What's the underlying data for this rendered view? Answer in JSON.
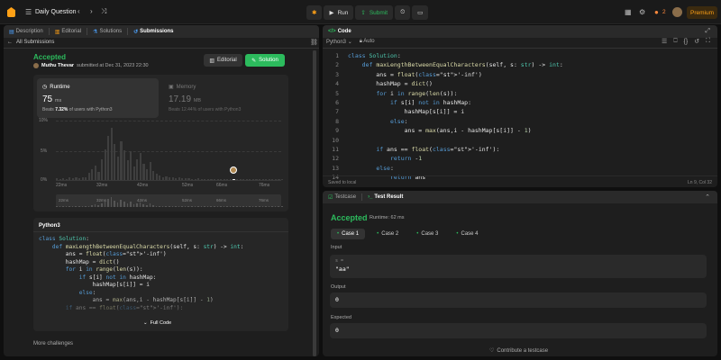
{
  "nav": {
    "title": "Daily Question",
    "run": "Run",
    "submit": "Submit",
    "streak": "2",
    "premium": "Premium"
  },
  "leftTabs": [
    {
      "label": "Description"
    },
    {
      "label": "Editorial"
    },
    {
      "label": "Solutions"
    },
    {
      "label": "Submissions"
    }
  ],
  "submission": {
    "back": "All Submissions",
    "status": "Accepted",
    "user": "Muthu Thevar",
    "submitted": "submitted at Dec 31, 2023 22:30",
    "editorial_btn": "Editorial",
    "solution_btn": "Solution",
    "runtime": {
      "label": "Runtime",
      "value": "75",
      "unit": "ms",
      "beats_label": "Beats",
      "beats": "7.32%",
      "beats_suffix": "of users with Python3"
    },
    "memory": {
      "label": "Memory",
      "value": "17.19",
      "unit": "MB",
      "beats_label": "Beats",
      "beats": "12.44%",
      "beats_suffix": "of users with Python3"
    },
    "y_ticks": [
      "10%",
      "5%",
      "0%"
    ],
    "x_ticks": [
      "22ms",
      "32ms",
      "42ms",
      "52ms",
      "66ms",
      "76ms"
    ],
    "mini_ticks": [
      "22ms",
      "32ms",
      "42ms",
      "52ms",
      "66ms",
      "76ms"
    ],
    "lang": "Python3",
    "full_code": "Full Code",
    "more": "More challenges"
  },
  "chart_data": {
    "type": "bar",
    "x": [
      20,
      21,
      22,
      23,
      24,
      25,
      26,
      27,
      28,
      29,
      30,
      31,
      32,
      33,
      34,
      35,
      36,
      37,
      38,
      39,
      40,
      41,
      42,
      43,
      44,
      45,
      46,
      47,
      48,
      49,
      50,
      51,
      52,
      53,
      54,
      55,
      56,
      57,
      58,
      59,
      60,
      61,
      62,
      63,
      64,
      65,
      66,
      67,
      68,
      69,
      70,
      71,
      72,
      73,
      74,
      75,
      76,
      77,
      78,
      79,
      80,
      81,
      82,
      83,
      84,
      85,
      86,
      87,
      88,
      89,
      90
    ],
    "values": [
      0.3,
      0.2,
      0.3,
      0.2,
      0.4,
      0.3,
      0.5,
      0.3,
      0.4,
      0.5,
      1.2,
      1.8,
      2.5,
      1.4,
      3.5,
      5.2,
      7.5,
      8.8,
      6.0,
      4.0,
      6.5,
      5.0,
      3.3,
      4.8,
      2.2,
      3.5,
      4.5,
      2.8,
      1.8,
      3.0,
      1.5,
      1.0,
      0.8,
      0.5,
      0.6,
      0.4,
      0.5,
      0.3,
      0.4,
      0.3,
      0.3,
      0.3,
      0.2,
      0.2,
      0.3,
      0.2,
      0.2,
      0.2,
      0.2,
      0.2,
      0.2,
      0.2,
      0.2,
      0.2,
      0.2,
      0.2,
      0.2,
      0.2,
      0.2,
      0.2,
      0.2,
      0.2,
      0.2,
      0.2,
      0.2,
      0.2,
      0.2,
      0.2,
      0.2,
      0.2,
      0.2
    ],
    "ylim": [
      0,
      10
    ],
    "xlim": [
      20,
      90
    ],
    "highlight_x": 75
  },
  "snippet": [
    "class Solution:",
    "    def maxLengthBetweenEqualCharacters(self, s: str) -> int:",
    "        ans = float('-inf')",
    "        hashMap = dict()",
    "        for i in range(len(s)):",
    "            if s[i] not in hashMap:",
    "                hashMap[s[i]] = i",
    "            else:",
    "                ans = max(ans,i - hashMap[s[i]] - 1)",
    "",
    "        if ans == float('-inf'):"
  ],
  "editor": {
    "title": "Code",
    "lang": "Python3",
    "auto": "Auto",
    "lines": [
      "class Solution:",
      "    def maxLengthBetweenEqualCharacters(self, s: str) -> int:",
      "        ans = float('-inf')",
      "        hashMap = dict()",
      "        for i in range(len(s)):",
      "            if s[i] not in hashMap:",
      "                hashMap[s[i]] = i",
      "            else:",
      "                ans = max(ans,i - hashMap[s[i]] - 1)",
      "",
      "        if ans == float('-inf'):",
      "            return -1",
      "        else:",
      "            return ans"
    ],
    "line_numbers": [
      "1",
      "2",
      "3",
      "4",
      "5",
      "6",
      "7",
      "8",
      "9",
      "10",
      "11",
      "12",
      "13",
      "14"
    ],
    "saved": "Saved to local",
    "cursor": "Ln 9, Col 32"
  },
  "result": {
    "tabs": [
      {
        "label": "Testcase"
      },
      {
        "label": "Test Result"
      }
    ],
    "status": "Accepted",
    "runtime": "Runtime: 62 ms",
    "cases": [
      "Case 1",
      "Case 2",
      "Case 3",
      "Case 4"
    ],
    "input_label": "Input",
    "input_var": "s =",
    "input_val": "\"aa\"",
    "output_label": "Output",
    "output_val": "0",
    "expected_label": "Expected",
    "expected_val": "0",
    "contribute": "Contribute a testcase"
  }
}
